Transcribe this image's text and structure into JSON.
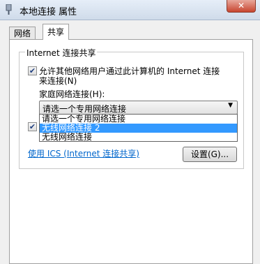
{
  "window": {
    "title": "本地连接 属性",
    "close_label": "✕"
  },
  "tabs": [
    {
      "label": "网络"
    },
    {
      "label": "共享"
    }
  ],
  "sharing": {
    "group_title": "Internet 连接共享",
    "allow_label_line1": "允许其他网络用户通过此计算机的 Internet 连接",
    "allow_label_line2": "来连接(N)",
    "allow_checked": true,
    "home_network_label": "家庭网络连接(H):",
    "combo_value": "请选一个专用网络连接",
    "combo_options": [
      "请选一个专用网络连接",
      "无线网络连接 2",
      "无线网络连接"
    ],
    "selected_option_index": 1,
    "second_checkbox_checked": true,
    "ics_link": "使用 ICS (Internet 连接共享)",
    "settings_button": "设置(G)..."
  }
}
